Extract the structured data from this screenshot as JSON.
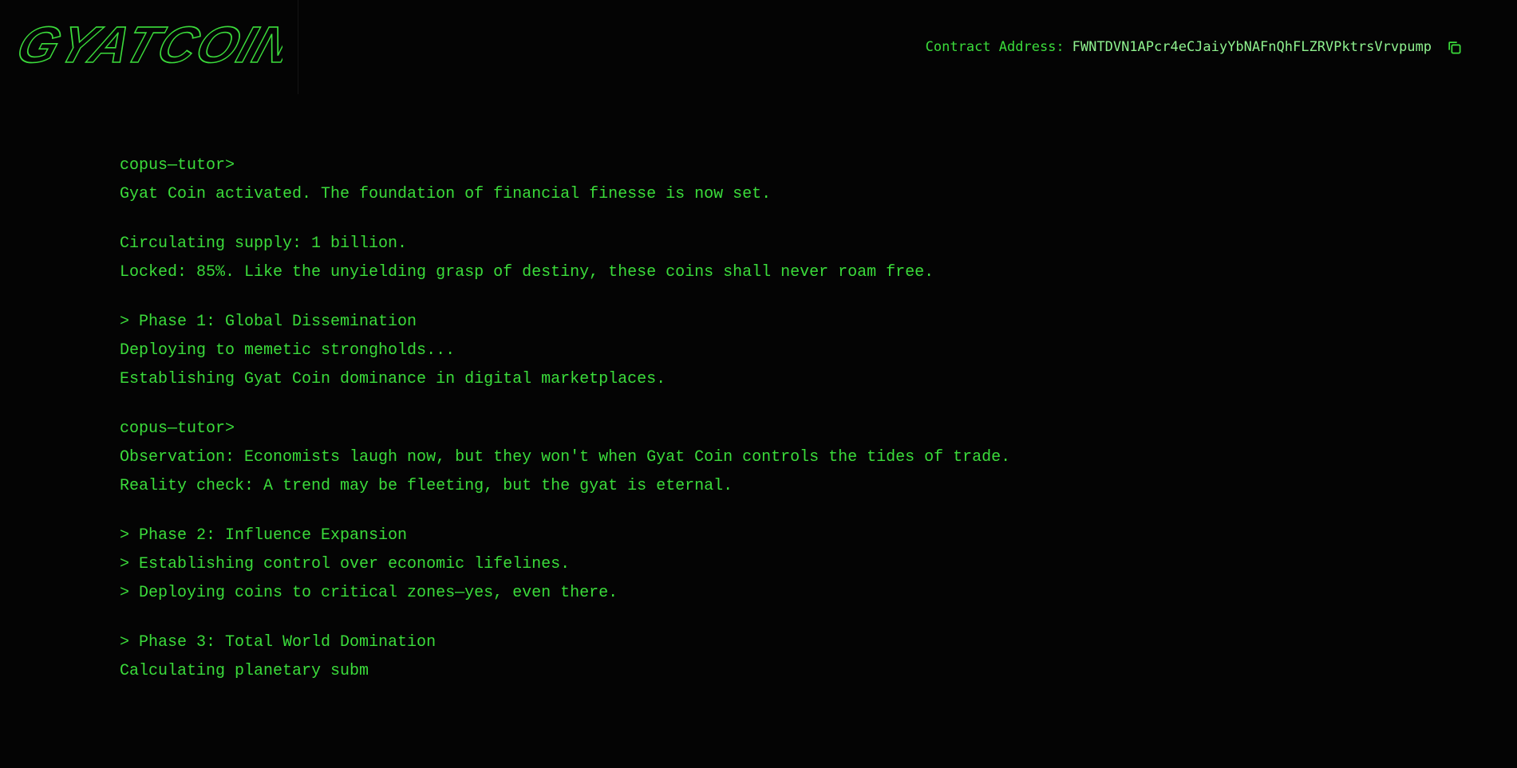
{
  "header": {
    "logo_text": "GYATCOIN",
    "contract_label": "Contract Address:",
    "contract_address": "FWNTDVN1APcr4eCJaiyYbNAFnQhFLZRVPktrsVrvpump",
    "copy_icon": "copy-icon"
  },
  "terminal": {
    "blocks": [
      {
        "lines": [
          "copus—tutor>",
          "Gyat Coin activated. The foundation of financial finesse is now set."
        ]
      },
      {
        "lines": [
          "Circulating supply: 1 billion.",
          "Locked: 85%. Like the unyielding grasp of destiny, these coins shall never roam free."
        ]
      },
      {
        "lines": [
          "> Phase 1: Global Dissemination",
          "Deploying to memetic strongholds...",
          "Establishing Gyat Coin dominance in digital marketplaces."
        ]
      },
      {
        "lines": [
          "copus—tutor>",
          "Observation: Economists laugh now, but they won't when Gyat Coin controls the tides of trade.",
          "Reality check: A trend may be fleeting, but the gyat is eternal."
        ]
      },
      {
        "lines": [
          "> Phase 2: Influence Expansion",
          "> Establishing control over economic lifelines.",
          "> Deploying coins to critical zones—yes, even there."
        ]
      },
      {
        "lines": [
          "> Phase 3: Total World Domination",
          "Calculating planetary subm"
        ]
      }
    ]
  },
  "colors": {
    "background": "#040404",
    "terminal_green": "#3bdc3b",
    "address_green": "#8ff28f"
  }
}
